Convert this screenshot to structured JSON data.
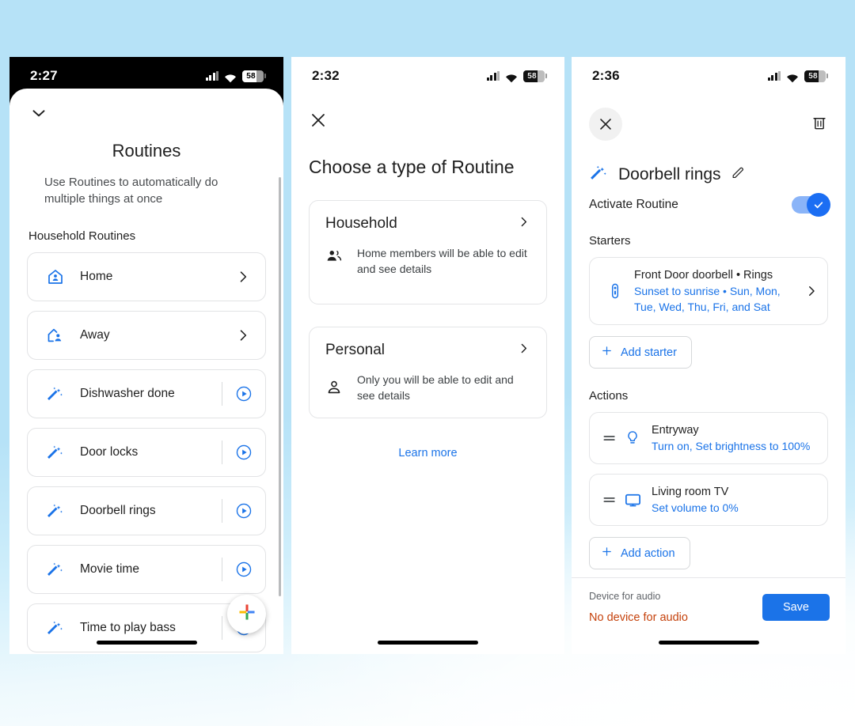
{
  "background": {
    "top_color": "#b6e2f7",
    "bottom_color": "#ffffff"
  },
  "panel1": {
    "status": {
      "time": "2:27",
      "battery": "58",
      "signal_icon": "cellular-signal-icon",
      "wifi_icon": "wifi-icon",
      "battery_icon": "battery-icon"
    },
    "collapse_icon": "chevron-down-icon",
    "title": "Routines",
    "subtitle": "Use Routines to automatically do multiple things at once",
    "section_label": "Household Routines",
    "routines": [
      {
        "label": "Home",
        "icon": "home-person-icon",
        "trailing": "chevron-right-icon"
      },
      {
        "label": "Away",
        "icon": "house-away-person-icon",
        "trailing": "chevron-right-icon"
      },
      {
        "label": "Dishwasher done",
        "icon": "magic-wand-icon",
        "trailing": "play-circle-icon"
      },
      {
        "label": "Door locks",
        "icon": "magic-wand-icon",
        "trailing": "play-circle-icon"
      },
      {
        "label": "Doorbell rings",
        "icon": "magic-wand-icon",
        "trailing": "play-circle-icon"
      },
      {
        "label": "Movie time",
        "icon": "magic-wand-icon",
        "trailing": "play-circle-icon"
      },
      {
        "label": "Time to play bass",
        "icon": "magic-wand-icon",
        "trailing": "play-circle-icon"
      }
    ],
    "fab_icon": "google-plus-add-icon"
  },
  "panel2": {
    "status": {
      "time": "2:32",
      "battery": "58"
    },
    "close_icon": "close-x-icon",
    "title": "Choose a type of Routine",
    "cards": [
      {
        "name": "Household",
        "description": "Home members will be able to edit and see details",
        "icon": "people-group-icon",
        "chevron": "chevron-right-icon"
      },
      {
        "name": "Personal",
        "description": "Only you will be able to edit and see details",
        "icon": "person-icon",
        "chevron": "chevron-right-icon"
      }
    ],
    "learn_more": "Learn more"
  },
  "panel3": {
    "status": {
      "time": "2:36",
      "battery": "58"
    },
    "close_icon": "close-x-icon",
    "delete_icon": "trash-icon",
    "routine_icon": "magic-wand-icon",
    "routine_title": "Doorbell rings",
    "edit_icon": "pencil-edit-icon",
    "activate_label": "Activate Routine",
    "activate_on": true,
    "toggle_color": "#1b6ef3",
    "starters_label": "Starters",
    "starters": [
      {
        "icon": "doorbell-device-icon",
        "primary": "Front Door doorbell • Rings",
        "secondary": "Sunset to sunrise • Sun, Mon, Tue, Wed, Thu, Fri, and Sat",
        "chevron": "chevron-right-icon"
      }
    ],
    "add_starter_label": "Add starter",
    "actions_label": "Actions",
    "actions": [
      {
        "drag": "drag-handle-icon",
        "icon": "lightbulb-icon",
        "primary": "Entryway",
        "secondary": "Turn on, Set brightness to 100%"
      },
      {
        "drag": "drag-handle-icon",
        "icon": "tv-icon",
        "primary": "Living room TV",
        "secondary": "Set volume to 0%"
      }
    ],
    "add_action_label": "Add action",
    "footer": {
      "audio_label": "Device for audio",
      "audio_value": "No device for audio",
      "audio_value_color": "#c5420c",
      "save_label": "Save",
      "save_color": "#1b73e8"
    }
  }
}
